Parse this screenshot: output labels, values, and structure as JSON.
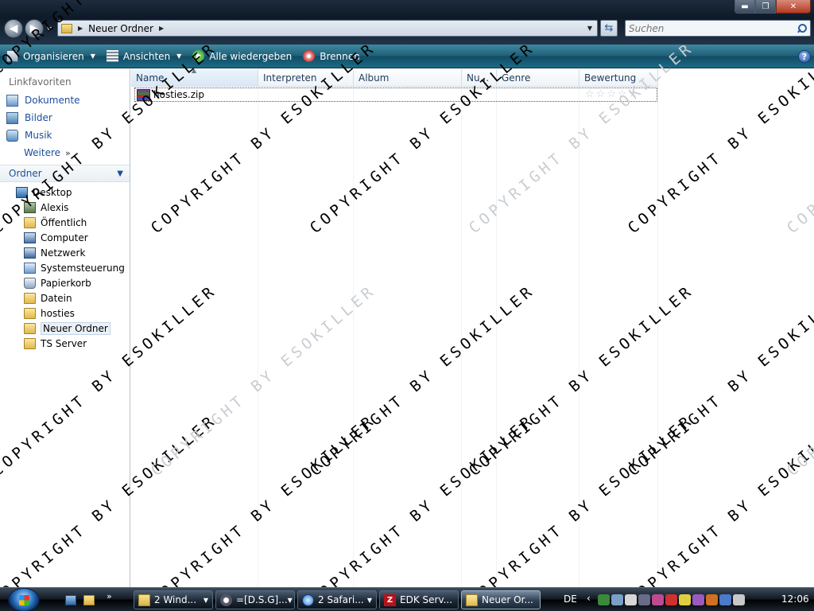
{
  "window": {
    "address": {
      "path_segment": "Neuer Ordner"
    },
    "search": {
      "placeholder": "Suchen"
    },
    "caption_buttons": {
      "minimize": "▬",
      "maximize": "❐",
      "close": "✕"
    }
  },
  "command_bar": {
    "items": [
      {
        "label": "Organisieren",
        "icon": "organize-icon",
        "has_dropdown": true
      },
      {
        "label": "Ansichten",
        "icon": "views-icon",
        "has_dropdown": true
      },
      {
        "label": "Alle wiedergeben",
        "icon": "play-icon",
        "has_dropdown": false
      },
      {
        "label": "Brennen",
        "icon": "burn-icon",
        "has_dropdown": false
      }
    ],
    "help": "?"
  },
  "nav_pane": {
    "favorites_header": "Linkfavoriten",
    "favorites": [
      {
        "label": "Dokumente",
        "icon": "documents-icon"
      },
      {
        "label": "Bilder",
        "icon": "pictures-icon"
      },
      {
        "label": "Musik",
        "icon": "music-icon"
      }
    ],
    "more_label": "Weitere",
    "folders_header": "Ordner",
    "tree": [
      {
        "label": "Desktop",
        "icon": "desktop-icon",
        "level": "root"
      },
      {
        "label": "Alexis",
        "icon": "user-folder-icon",
        "level": "child"
      },
      {
        "label": "Öffentlich",
        "icon": "folder-icon",
        "level": "child"
      },
      {
        "label": "Computer",
        "icon": "computer-icon",
        "level": "child"
      },
      {
        "label": "Netzwerk",
        "icon": "network-icon",
        "level": "child"
      },
      {
        "label": "Systemsteuerung",
        "icon": "control-panel-icon",
        "level": "child"
      },
      {
        "label": "Papierkorb",
        "icon": "recycle-bin-icon",
        "level": "child"
      },
      {
        "label": "Datein",
        "icon": "folder-icon",
        "level": "child"
      },
      {
        "label": "hosties",
        "icon": "folder-icon",
        "level": "child"
      },
      {
        "label": "Neuer Ordner",
        "icon": "folder-icon",
        "level": "child",
        "selected": true
      },
      {
        "label": "TS Server",
        "icon": "folder-icon",
        "level": "child"
      }
    ]
  },
  "file_list": {
    "columns": [
      "Name",
      "Interpreten",
      "Album",
      "Nu...",
      "Genre",
      "Bewertung"
    ],
    "sorted_column": "Name",
    "rows": [
      {
        "name": "hosties.zip",
        "icon": "zip-archive-icon",
        "rating_stars": 0,
        "rating_max": 5
      }
    ]
  },
  "watermark": {
    "text": "COPYRIGHT BY ESOKILLER"
  },
  "taskbar": {
    "buttons": [
      {
        "label": "2 Wind...",
        "icon": "explorer-icon",
        "has_dropdown": true
      },
      {
        "label": "=[D.S.G]...",
        "icon": "steam-icon",
        "has_dropdown": true
      },
      {
        "label": "2 Safari...",
        "icon": "safari-icon",
        "has_dropdown": true
      },
      {
        "label": "EDK Serv...",
        "icon": "filezilla-icon",
        "has_dropdown": false
      },
      {
        "label": "Neuer Or...",
        "icon": "folder-icon",
        "has_dropdown": false,
        "active": true
      }
    ],
    "language": "DE",
    "clock": "12:06",
    "tray_colors": [
      "#3a8a3a",
      "#7aa0c8",
      "#d6d6d6",
      "#6a6a8a",
      "#c04a90",
      "#d03030",
      "#e0d040",
      "#9a5ac0",
      "#d07020",
      "#4a7ac8",
      "#c8c8c8"
    ]
  }
}
